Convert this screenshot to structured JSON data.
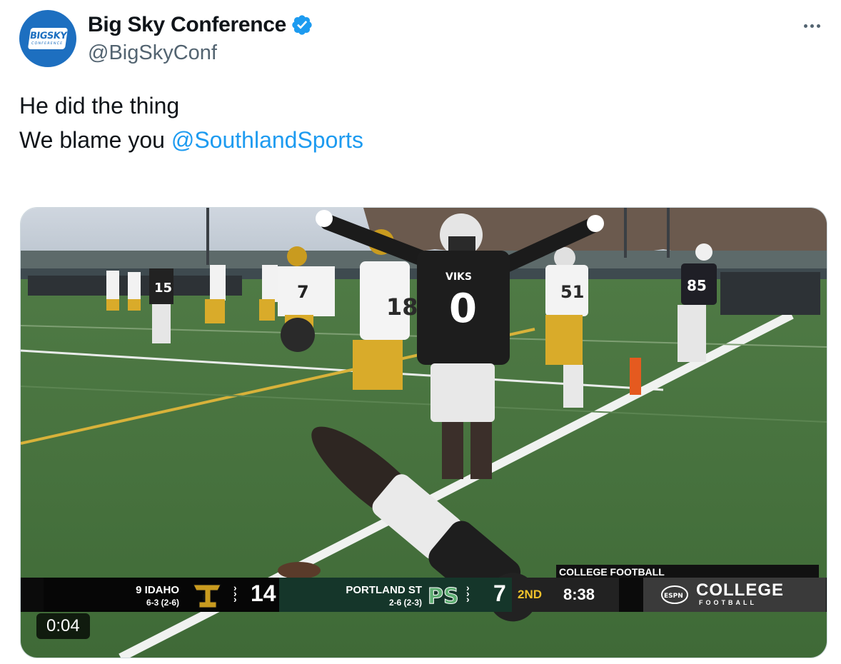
{
  "author": {
    "display_name": "Big Sky Conference",
    "handle": "@BigSkyConf",
    "avatar_text": "BIGSKY",
    "avatar_subtext": "CONFERENCE",
    "verified_icon": "verified-badge-icon",
    "brand_color": "#1d6fc0"
  },
  "tweet": {
    "line1": "He did the thing",
    "line2_prefix": "We blame you ",
    "mention": "@SouthlandSports",
    "mention_color": "#1d9bf0"
  },
  "media": {
    "video_timestamp": "0:04",
    "scorebug": {
      "network_label": "COLLEGE FOOTBALL",
      "away": {
        "name": "9 IDAHO",
        "record": "6-3 (2-6)",
        "score": "14",
        "logo_text": "I"
      },
      "home": {
        "name": "PORTLAND ST",
        "record": "2-6 (2-3)",
        "score": "7",
        "logo_text": "PS"
      },
      "period": "2ND",
      "clock": "8:38",
      "brand_logo": "ESPN",
      "brand_title": "COLLEGE",
      "brand_subtitle": "FOOTBALL"
    },
    "players": {
      "center_player_jersey": "0",
      "center_player_chest": "VIKS",
      "gold_player_jersey": "18",
      "gold_player_jersey_2": "7",
      "gold_player_jersey_3": "51",
      "far_player_jersey": "85",
      "far_player_jersey_2": "15"
    }
  }
}
